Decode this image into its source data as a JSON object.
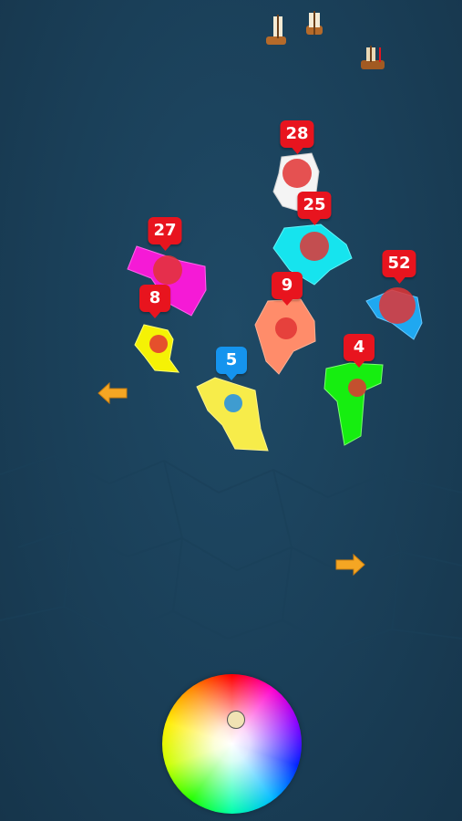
{
  "islands": [
    {
      "id": "white",
      "count": "28",
      "fill": "#f4f4f4",
      "badge": "#e8141e",
      "troop_color": "#e23434"
    },
    {
      "id": "cyan",
      "count": "25",
      "fill": "#16e4ee",
      "badge": "#e8141e",
      "troop_color": "#e23434"
    },
    {
      "id": "magenta",
      "count": "27",
      "fill": "#f51ad6",
      "badge": "#e8141e",
      "troop_color": "#e23434"
    },
    {
      "id": "sky-blue",
      "count": "52",
      "fill": "#1fa8f0",
      "badge": "#e8141e",
      "troop_color": "#e23434"
    },
    {
      "id": "salmon",
      "count": "9",
      "fill": "#ff8c6a",
      "badge": "#e8141e",
      "troop_color": "#e23434"
    },
    {
      "id": "yellow-small",
      "count": "8",
      "fill": "#f5f205",
      "badge": "#e8141e",
      "troop_color": "#e23434"
    },
    {
      "id": "green",
      "count": "4",
      "fill": "#16ee10",
      "badge": "#e8141e",
      "troop_color": "#e23434"
    },
    {
      "id": "yellow-player",
      "count": "5",
      "fill": "#f7ec4a",
      "badge": "#1594ee",
      "troop_color": "#1f8ee8"
    }
  ],
  "arrows": {
    "left": "left-arrow-icon",
    "right": "right-arrow-icon",
    "color": "#f5a623"
  },
  "color_wheel": {
    "icon": "color-wheel",
    "selected": "#f1e3b4"
  },
  "ships": [
    "ship-icon",
    "ship-icon",
    "ship-icon"
  ],
  "ocean_color": "#1d4560"
}
